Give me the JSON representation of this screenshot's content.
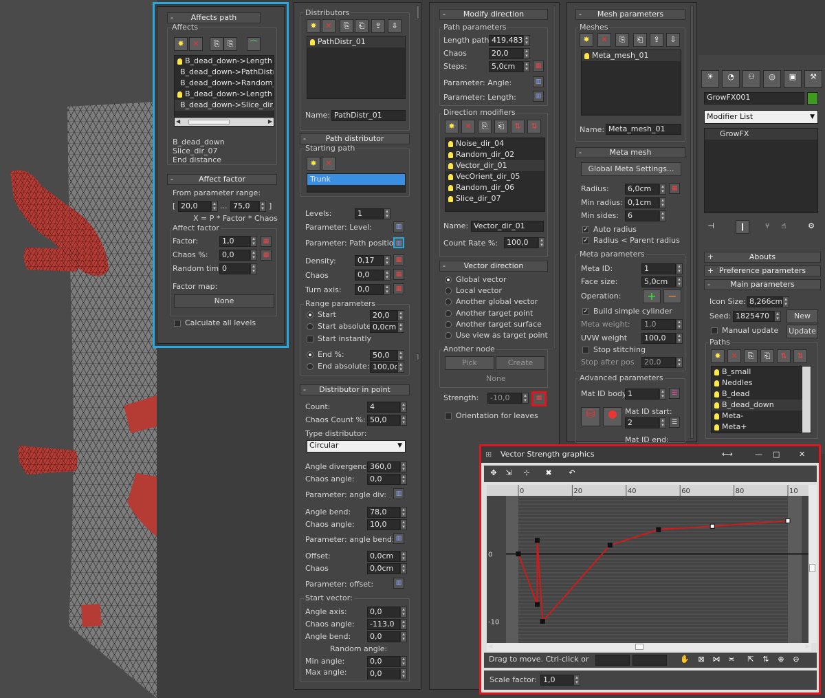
{
  "viewport": {
    "trunk_color": "#7d7d7d",
    "branch_color": "#b43c34"
  },
  "affects_panel": {
    "title": "Affects path",
    "affects_label": "Affects",
    "affects_list": [
      "B_dead_down->Length",
      "B_dead_down->PathDistr",
      "B_dead_down->Random_",
      "B_dead_down->Length",
      "B_dead_down->Slice_dir_"
    ],
    "info": [
      "B_dead_down",
      "Slice_dir_07",
      "End distance"
    ],
    "factor_title": "Affect factor",
    "from_range_label": "From parameter range:",
    "range_from": "20,0",
    "range_dots": "...",
    "range_to": "75,0",
    "bracket_open": "[",
    "bracket_close": "]",
    "formula": "X = P * Factor * Chaos",
    "affect_factor_label": "Affect factor",
    "factor_label": "Factor:",
    "factor_value": "1,0",
    "chaos_label": "Chaos %:",
    "chaos_value": "0,0",
    "random_time_label": "Random time:",
    "random_time_value": "0",
    "factor_map_label": "Factor map:",
    "factor_map_button": "None",
    "calc_all_label": "Calculate all levels",
    "highlight_color": "#29a8e0"
  },
  "distributors_panel": {
    "title": "Distributors",
    "list": [
      "PathDistr_01"
    ],
    "name_label": "Name:",
    "name_value": "PathDistr_01",
    "path_dist_title": "Path distributor",
    "starting_path_label": "Starting path",
    "starting_path_item": "Trunk",
    "levels_label": "Levels:",
    "levels_value": "1",
    "param_level_label": "Parameter: Level:",
    "param_path_pos_label": "Parameter: Path position:",
    "density_label": "Density:",
    "density_value": "0,17",
    "chaos_label": "Chaos",
    "chaos_value": "0,0",
    "turn_axis_label": "Turn axis:",
    "turn_axis_value": "0,0",
    "range_params_label": "Range parameters",
    "start_label": "Start",
    "start_value": "20,0",
    "start_abs_label": "Start absolute:",
    "start_abs_value": "0,0cm",
    "start_instantly_label": "Start instantly",
    "end_pct_label": "End %:",
    "end_pct_value": "50,0",
    "end_abs_label": "End absolute:",
    "end_abs_value": "100,0c",
    "dip_title": "Distributor in point",
    "count_label": "Count:",
    "count_value": "4",
    "chaos_count_label": "Chaos Count %:",
    "chaos_count_value": "50,0",
    "type_dist_label": "Type distributor:",
    "type_dist_value": "Circular",
    "angle_div_label": "Angle divergence:",
    "angle_div_value": "360,0",
    "chaos_angle_label": "Chaos angle:",
    "chaos_angle_value": "0,0",
    "param_angle_div_label": "Parameter: angle div:",
    "angle_bend_label": "Angle bend:",
    "angle_bend_value": "78,0",
    "chaos_angle2_label": "Chaos angle:",
    "chaos_angle2_value": "10,0",
    "param_angle_bend_label": "Parameter: angle bend:",
    "offset_label": "Offset:",
    "offset_value": "0,0cm",
    "offset_chaos_label": "Chaos",
    "offset_chaos_value": "0,0cm",
    "param_offset_label": "Parameter: offset:",
    "start_vector_label": "Start vector:",
    "angle_axis_label": "Angle axis:",
    "angle_axis_value": "0,0",
    "chaos_angle3_label": "Chaos angle:",
    "chaos_angle3_value": "-113,0",
    "angle_bend2_label": "Angle bend:",
    "angle_bend2_value": "0,0",
    "random_angle_label": "Random angle:",
    "min_angle_label": "Min angle:",
    "min_angle_value": "0,0",
    "max_angle_label": "Max angle:",
    "max_angle_value": "0,0"
  },
  "modify_panel": {
    "title": "Modify direction",
    "path_params_label": "Path parameters",
    "length_label": "Length path:",
    "length_value": "419,483",
    "chaos_label": "Chaos",
    "chaos_value": "20,0",
    "steps_label": "Steps:",
    "steps_value": "5,0cm",
    "param_angle_label": "Parameter: Angle:",
    "param_length_label": "Parameter: Length:",
    "dir_mod_label": "Direction modifiers",
    "modifiers": [
      "Noise_dir_04",
      "Random_dir_02",
      "Vector_dir_01",
      "VecOrient_dir_05",
      "Random_dir_06",
      "Slice_dir_07"
    ],
    "name_label": "Name:",
    "name_value": "Vector_dir_01",
    "count_rate_label": "Count Rate %:",
    "count_rate_value": "100,0",
    "vector_title": "Vector direction",
    "radios": [
      "Global vector",
      "Local vector",
      "Another global vector",
      "Another target point",
      "Another target surface",
      "Use view as target point"
    ],
    "another_node_label": "Another node",
    "pick_label": "Pick",
    "create_label": "Create",
    "none_label": "None",
    "strength_label": "Strength:",
    "strength_value": "-10,0",
    "orientation_label": "Orientation for leaves"
  },
  "mesh_panel": {
    "title": "Mesh parameters",
    "meshes_label": "Meshes",
    "list": [
      "Meta_mesh_01"
    ],
    "name_label": "Name:",
    "name_value": "Meta_mesh_01",
    "meta_title": "Meta mesh",
    "global_meta_button": "Global Meta Settings...",
    "radius_label": "Radius:",
    "radius_value": "6,0cm",
    "min_radius_label": "Min radius:",
    "min_radius_value": "0,1cm",
    "min_sides_label": "Min sides:",
    "min_sides_value": "6",
    "auto_radius_label": "Auto radius",
    "radius_parent_label": "Radius < Parent radius",
    "meta_params_label": "Meta parameters",
    "meta_id_label": "Meta ID:",
    "meta_id_value": "1",
    "face_size_label": "Face size:",
    "face_size_value": "5,0cm",
    "operation_label": "Operation:",
    "build_cyl_label": "Build simple cylinder",
    "meta_weight_label": "Meta weight:",
    "meta_weight_value": "1,0",
    "uvw_weight_label": "UVW weight",
    "uvw_weight_value": "100,0",
    "stop_stitching_label": "Stop stitching",
    "stop_after_label": "Stop after pos",
    "stop_after_value": "20,0",
    "adv_label": "Advanced parameters",
    "mat_id_body_label": "Mat ID body:",
    "mat_id_body_value": "1",
    "mat_id_start_label": "Mat ID start:",
    "mat_id_start_value": "2",
    "mat_id_end_label": "Mat ID end:"
  },
  "cmd_panel": {
    "object_name": "GrowFX001",
    "object_color": "#3f9a1f",
    "modifier_list_label": "Modifier List",
    "stack_item": "GrowFX",
    "abouts": "Abouts",
    "pref_params": "Preference parameters",
    "main_params": "Main parameters",
    "icon_size_label": "Icon Size:",
    "icon_size_value": "8,266cm",
    "seed_label": "Seed:",
    "seed_value": "1825470",
    "new_label": "New",
    "manual_update_label": "Manual update",
    "update_label": "Update",
    "paths_label": "Paths",
    "paths": [
      "B_small",
      "Neddles",
      "B_dead",
      "B_dead_down",
      "Meta-",
      "Meta+"
    ]
  },
  "graph_window": {
    "title": "Vector Strength graphics",
    "status_text": "Drag to move. Ctrl-click or drag",
    "scale_label": "Scale factor:",
    "scale_value": "1,0",
    "ruler_ticks": [
      "0",
      "20",
      "40",
      "60",
      "80",
      "10"
    ],
    "y_ticks": [
      "0",
      "-10"
    ],
    "highlight_color": "#e0161c"
  },
  "chart_data": {
    "type": "line",
    "x": [
      0,
      7,
      7,
      9,
      34,
      52,
      72,
      100
    ],
    "y": [
      0,
      -7.5,
      2,
      -10,
      1.3,
      3.6,
      4.1,
      4.9
    ],
    "xlim": [
      0,
      100
    ],
    "ylim": [
      -13,
      8
    ]
  }
}
